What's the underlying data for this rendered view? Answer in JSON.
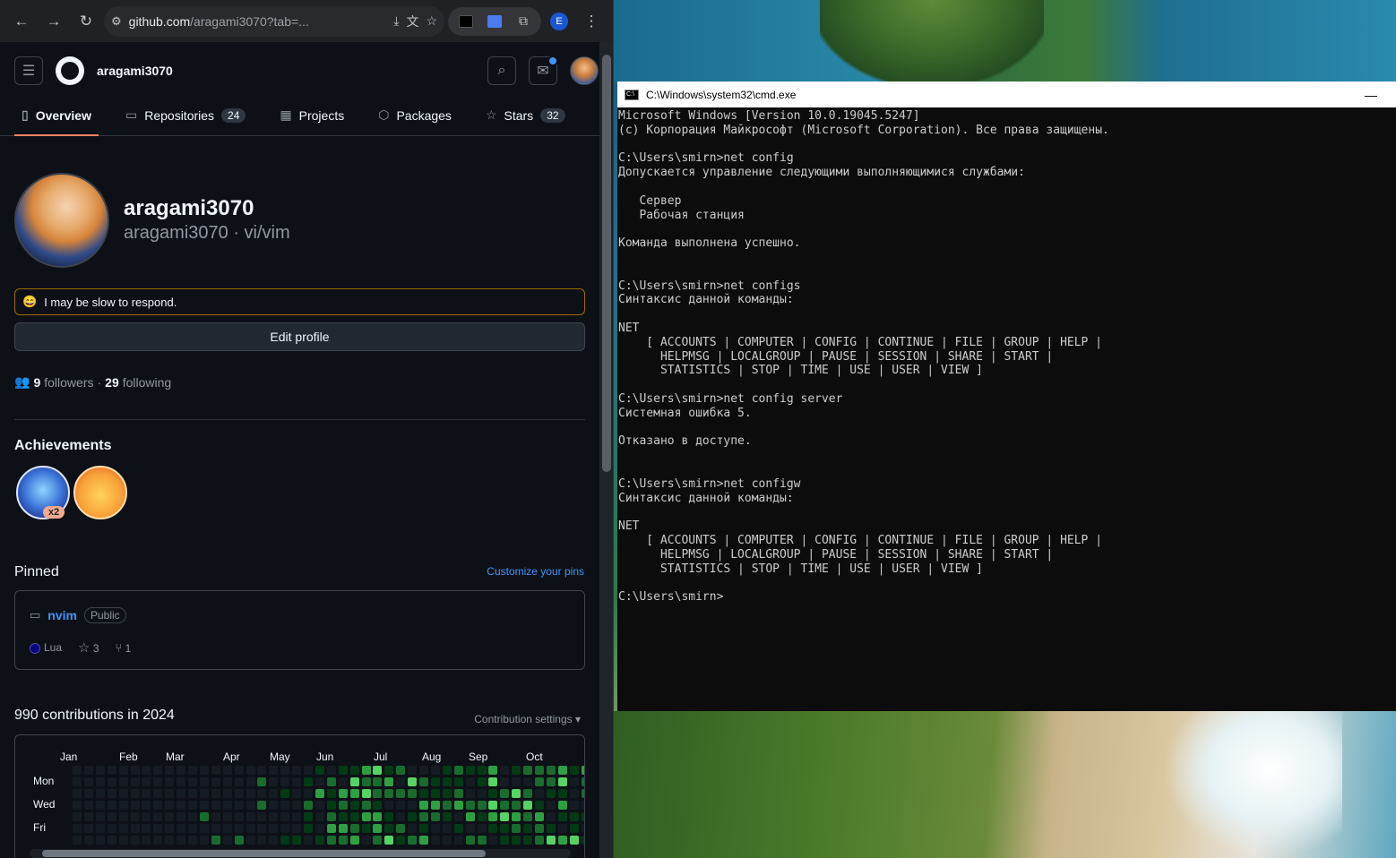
{
  "browser": {
    "url_host": "github.com",
    "url_path": "/aragami3070?tab=...",
    "profile_initial": "E"
  },
  "github": {
    "header_username": "aragami3070",
    "tabs": [
      {
        "label": "Overview",
        "icon": "book-icon"
      },
      {
        "label": "Repositories",
        "icon": "repo-icon",
        "count": "24"
      },
      {
        "label": "Projects",
        "icon": "table-icon"
      },
      {
        "label": "Packages",
        "icon": "package-icon"
      },
      {
        "label": "Stars",
        "icon": "star-icon",
        "count": "32"
      }
    ],
    "profile": {
      "name": "aragami3070",
      "login_line": "aragami3070 · vi/vim",
      "status_emoji": "😄",
      "status_text": "I may be slow to respond.",
      "edit_label": "Edit profile",
      "followers_count": "9",
      "followers_label": "followers",
      "following_count": "29",
      "following_label": "following"
    },
    "achievements": {
      "title": "Achievements",
      "badges": [
        {
          "name": "shark-badge",
          "multiplier": "x2"
        },
        {
          "name": "quickdraw-badge"
        }
      ]
    },
    "pinned": {
      "title": "Pinned",
      "customize_label": "Customize your pins",
      "repo": {
        "name": "nvim",
        "visibility": "Public",
        "language": "Lua",
        "language_color": "#000080",
        "stars": "3",
        "forks": "1"
      }
    },
    "contributions": {
      "title": "990 contributions in 2024",
      "settings_label": "Contribution settings ▾",
      "months": [
        "Jan",
        "Feb",
        "Mar",
        "Apr",
        "May",
        "Jun",
        "Jul",
        "Aug",
        "Sep",
        "Oct"
      ],
      "days": [
        "Mon",
        "Wed",
        "Fri"
      ],
      "colors": [
        "#151b23",
        "#033a16",
        "#196c2e",
        "#2ea043",
        "#56d364"
      ]
    }
  },
  "cmd": {
    "title": "C:\\Windows\\system32\\cmd.exe",
    "minimize_label": "—",
    "lines": [
      "Microsoft Windows [Version 10.0.19045.5247]",
      "(c) Корпорация Майкрософт (Microsoft Corporation). Все права защищены.",
      "",
      "C:\\Users\\smirn>net config",
      "Допускается управление следующими выполняющимися службами:",
      "",
      "   Сервер",
      "   Рабочая станция",
      "",
      "Команда выполнена успешно.",
      "",
      "",
      "C:\\Users\\smirn>net configs",
      "Синтаксис данной команды:",
      "",
      "NET",
      "    [ ACCOUNTS | COMPUTER | CONFIG | CONTINUE | FILE | GROUP | HELP |",
      "      HELPMSG | LOCALGROUP | PAUSE | SESSION | SHARE | START |",
      "      STATISTICS | STOP | TIME | USE | USER | VIEW ]",
      "",
      "C:\\Users\\smirn>net config server",
      "Системная ошибка 5.",
      "",
      "Отказано в доступе.",
      "",
      "",
      "C:\\Users\\smirn>net configw",
      "Синтаксис данной команды:",
      "",
      "NET",
      "    [ ACCOUNTS | COMPUTER | CONFIG | CONTINUE | FILE | GROUP | HELP |",
      "      HELPMSG | LOCALGROUP | PAUSE | SESSION | SHARE | START |",
      "      STATISTICS | STOP | TIME | USE | USER | VIEW ]",
      "",
      "C:\\Users\\smirn>"
    ]
  }
}
